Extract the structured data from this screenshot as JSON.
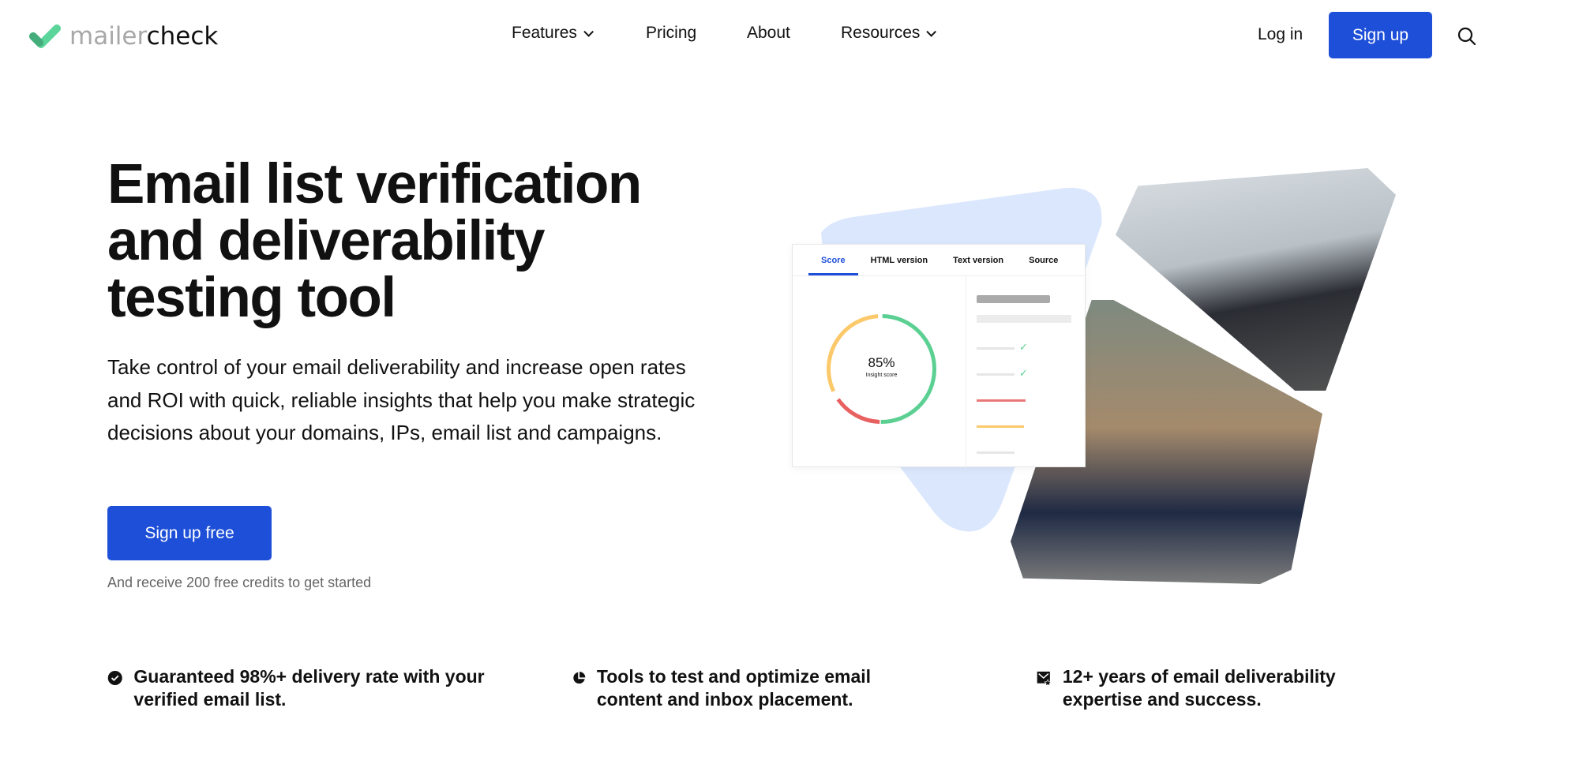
{
  "brand": {
    "part1": "mailer",
    "part2": "check",
    "accent": "#5cd59a"
  },
  "nav": {
    "items": [
      {
        "label": "Features",
        "dropdown": true
      },
      {
        "label": "Pricing"
      },
      {
        "label": "About"
      },
      {
        "label": "Resources",
        "dropdown": true
      }
    ],
    "login": "Log in",
    "signup": "Sign up",
    "search_icon": "search-icon"
  },
  "hero": {
    "title": "Email list verification and deliverability testing tool",
    "lead": "Take control of your email deliverability and increase open rates and ROI with quick, reliable insights that help you make strategic decisions about your domains, IPs, email list and campaigns.",
    "cta": "Sign up free",
    "note": "And receive 200 free credits to get started",
    "primary_color": "#1e4fd8"
  },
  "card": {
    "tabs": [
      "Score",
      "HTML version",
      "Text version",
      "Source"
    ],
    "score": "85%",
    "score_label": "Insight score"
  },
  "features": [
    {
      "icon": "check-circle-icon",
      "text": "Guaranteed 98%+ delivery rate with your verified email list."
    },
    {
      "icon": "pie-chart-icon",
      "text": "Tools to test and optimize email content and inbox placement."
    },
    {
      "icon": "email-star-icon",
      "text": "12+ years of email deliverability expertise and success."
    }
  ]
}
